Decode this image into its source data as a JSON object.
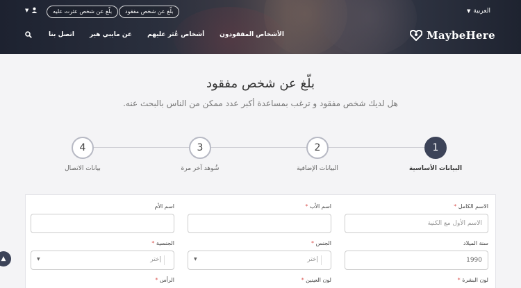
{
  "header": {
    "language": "العربية",
    "pill_report": "بلّغ عن شخص مفقود",
    "pill_found": "بلّغ عن شخص عثرت عليه",
    "logo_text": "MaybeHere",
    "nav": {
      "missing": "الأشخاص المفقودون",
      "found": "أشخاص عُثر عليهم",
      "about": "عن مايبي هير",
      "contact": "اتصل بنا"
    }
  },
  "page": {
    "title": "بلّغ عن شخص مفقود",
    "subtitle": "هل لديك شخص مفقود و ترغب بمساعدة أكبر عدد ممكن من الناس بالبحث عنه."
  },
  "steps": [
    {
      "number": "1",
      "label": "البيانات الأساسية"
    },
    {
      "number": "2",
      "label": "البيانات الإضافية"
    },
    {
      "number": "3",
      "label": "شُوهد آخر مرة"
    },
    {
      "number": "4",
      "label": "بيانات الاتصال"
    }
  ],
  "form": {
    "full_name_label": "الاسم الكامل",
    "full_name_placeholder": "الاسم الأول مع الكنية",
    "father_name_label": "اسم الأب",
    "mother_name_label": "اسم الأم",
    "birth_year_label": "سنة الميلاد",
    "birth_year_value": "1990",
    "gender_label": "الجنس",
    "gender_value": "إختر",
    "nationality_label": "الجنسية",
    "nationality_value": "إختر",
    "skin_color_label": "لون البشرة",
    "eye_color_label": "لون العينين",
    "head_label": "الرأس",
    "required_mark": "*"
  },
  "colors": {
    "accent": "#3c4358",
    "required": "#d9534f"
  }
}
